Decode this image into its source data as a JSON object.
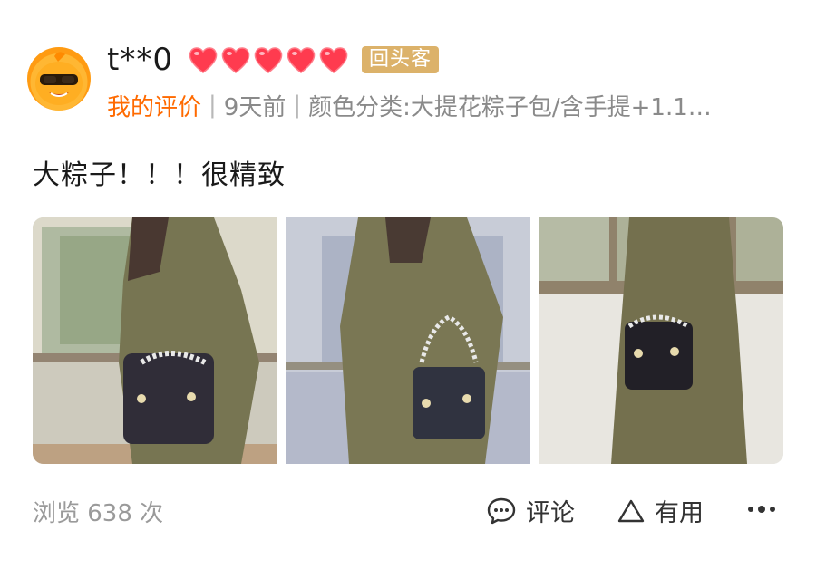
{
  "user": {
    "name": "t**0",
    "badge": "回头客",
    "heart_count": 5,
    "heart_color": "#ff3b4f"
  },
  "meta": {
    "my_review": "我的评价",
    "time": "9天前",
    "variant": "颜色分类:大提花粽子包/含手提+1.1…"
  },
  "review": {
    "text": "大粽子！！！很精致"
  },
  "photos": [
    {
      "name": "review-photo-1"
    },
    {
      "name": "review-photo-2"
    },
    {
      "name": "review-photo-3"
    }
  ],
  "footer": {
    "views": "浏览 638 次",
    "comment_label": "评论",
    "useful_label": "有用"
  },
  "colors": {
    "accent": "#ff6a00",
    "badge_bg": "#dcb26a",
    "muted_text": "#8a8a8a"
  }
}
